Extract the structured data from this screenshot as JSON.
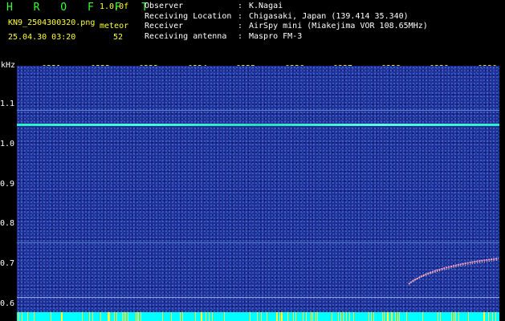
{
  "header": {
    "title": "H R O F F T",
    "version": "1.0.0f",
    "filename": "KN9_2504300320.png",
    "meteor_label": "meteor",
    "datetime": "25.04.30 03:20",
    "meteor_count": "52"
  },
  "info": [
    {
      "key": "Observer",
      "value": "K.Nagai"
    },
    {
      "key": "Receiving Location",
      "value": "Chigasaki, Japan (139.414 35.340)"
    },
    {
      "key": "Receiver",
      "value": "AirSpy mini (Miakejima VOR 108.65MHz)"
    },
    {
      "key": "Receiving antenna",
      "value": "Maspro FM-3"
    }
  ],
  "spectrogram": {
    "unit": "kHz",
    "x_labels": [
      "0321",
      "0322",
      "0323",
      "0324",
      "0325",
      "0326",
      "0327",
      "0328",
      "0329",
      "0330"
    ],
    "y_labels": [
      "1.1",
      "1.0",
      "0.9",
      "0.8",
      "0.7",
      "0.6"
    ],
    "colors": {
      "background": "#1e2f9a",
      "carrier": "#33ffcc",
      "bar": "#00ffff",
      "tick": "#ffff33"
    }
  }
}
